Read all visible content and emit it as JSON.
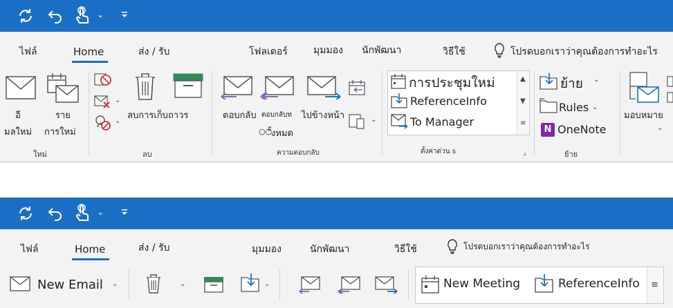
{
  "top": {
    "tabs": {
      "file": "ไฟล์",
      "home": "Home",
      "send_receive": "ส่ง / รับ",
      "folder": "โฟลเดอร์",
      "view": "มุมมอง",
      "developer": "นักพัฒนา",
      "help": "วิธีใช้"
    },
    "tell_me": "โปรดบอกเราว่าคุณต้องการทำอะไร",
    "new_group": {
      "new_email": "อี\nมลใหม่",
      "new_items": "ราย\nการใหม่",
      "label": "ใหม่"
    },
    "delete_group": {
      "archive": "ลบการเก็บถาวร",
      "label": "ลบ"
    },
    "respond_group": {
      "reply": "ตอบกลับ",
      "reply_all": "ตอบกลับท",
      "forward": "ไปข้างหน้า",
      "more": "ั้งหมด",
      "label": "ความตอบกลับ"
    },
    "quick_steps": {
      "items": [
        "การประชุมใหม่",
        "ReferenceInfo",
        "To Manager"
      ],
      "label": "ตั้งค่าด่วน s"
    },
    "move_group": {
      "move": "ย้าย",
      "rules": "Rules",
      "onenote": "OneNote",
      "label": "ย้าย"
    },
    "tags_group": {
      "assign": "มอบหมาย"
    }
  },
  "bottom": {
    "tabs": {
      "file": "ไฟล์",
      "home": "Home",
      "send_receive": "ส่ง / รับ",
      "view": "มุมมอง",
      "developer": "นักพัฒนา",
      "help": "วิธีใช้"
    },
    "tell_me": "โปรดบอกเราว่าคุณต้องการทำอะไร",
    "new_email": "New Email",
    "quick_steps": [
      "New Meeting",
      "ReferenceInfo"
    ]
  },
  "colors": {
    "accent": "#1a6fc4",
    "ribbon": "#f3f3f3",
    "red_x": "#d13438",
    "purple": "#8764b8"
  }
}
